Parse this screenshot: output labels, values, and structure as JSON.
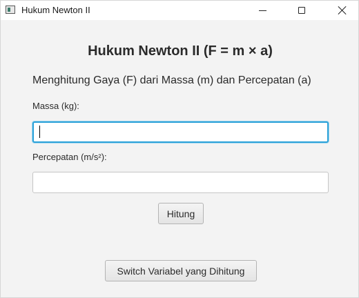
{
  "window": {
    "title": "Hukum Newton II",
    "controls": {
      "minimize": "minimize-icon",
      "maximize": "maximize-icon",
      "close": "close-icon"
    }
  },
  "main": {
    "heading": "Hukum Newton II (F = m × a)",
    "subtitle": "Menghitung Gaya (F) dari Massa (m) dan Percepatan (a)",
    "massa_label": "Massa (kg):",
    "massa_value": "",
    "percepatan_label": "Percepatan (m/s²):",
    "percepatan_value": "",
    "hitung_label": "Hitung",
    "switch_label": "Switch Variabel yang Dihitung"
  },
  "colors": {
    "focus_border": "#2aa1d8",
    "background": "#f3f3f3"
  }
}
